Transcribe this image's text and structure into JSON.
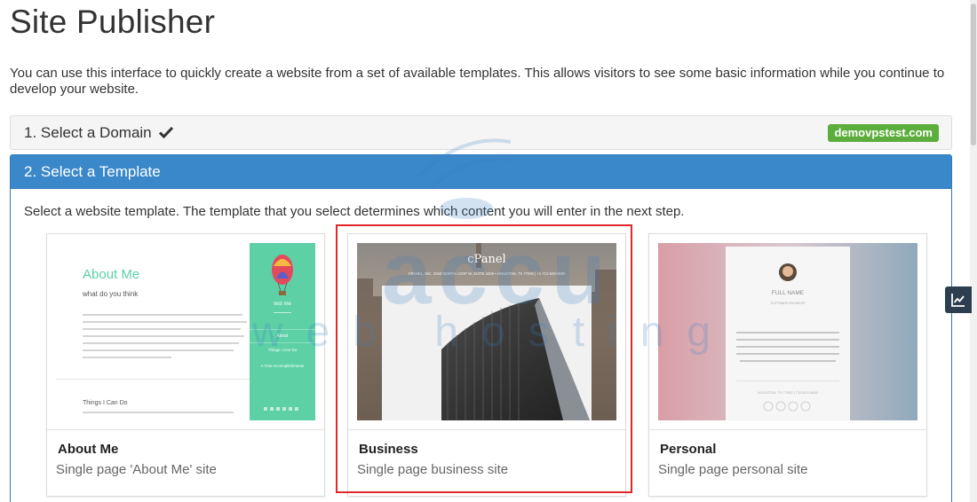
{
  "page": {
    "title": "Site Publisher",
    "intro": "You can use this interface to quickly create a website from a set of available templates. This allows visitors to see some basic information while you continue to develop your website."
  },
  "step1": {
    "label": "1. Select a Domain",
    "domain": "demovpstest.com",
    "check_icon": "check-icon",
    "badge_color": "#5cae3c"
  },
  "step2": {
    "label": "2. Select a Template",
    "description": "Select a website template. The template that you select determines which content you will enter in the next step.",
    "header_color": "#3a88c9"
  },
  "templates": [
    {
      "name": "About Me",
      "description": "Single page 'About Me' site",
      "thumb": {
        "heading": "About Me",
        "subheading": "what do you think",
        "section": "Things I Can Do",
        "sidebar_name": "test me",
        "sidebar_links": [
          "About",
          "Things I Can Do",
          "A Few Accomplishments"
        ],
        "accent": "#5dd0a6"
      }
    },
    {
      "name": "Business",
      "description": "Single page business site",
      "selected": true,
      "thumb": {
        "brand": "cPanel",
        "address": "CPANEL, INC. 2550 NORTH LOOP W, SUITE 4006 • HOUSTON, TX 77092 | +1 713-529-0800"
      }
    },
    {
      "name": "Personal",
      "description": "Single page personal site",
      "thumb": {
        "full_name": "FULL NAME",
        "job_title": "SOFTWARE ENGINEER",
        "location": "HOUSTON, TX 77092 | 713-529-0800"
      }
    }
  ],
  "watermark": {
    "text_top": "accu",
    "text_bottom": "web hosting"
  },
  "side_button": {
    "icon": "line-chart-icon"
  }
}
